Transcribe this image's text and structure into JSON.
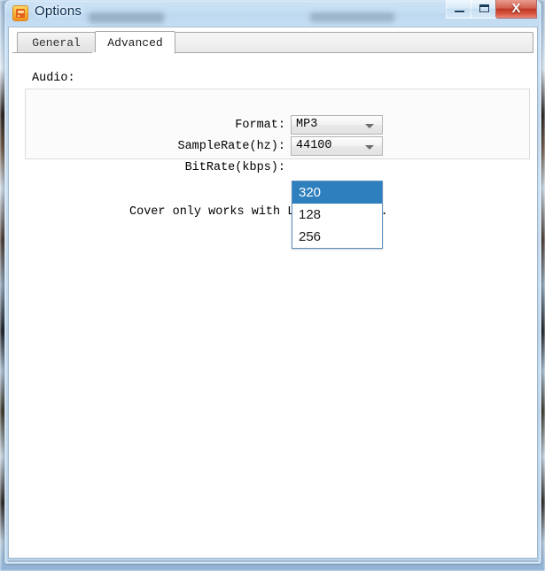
{
  "window": {
    "title": "Options",
    "icon": "app-icon",
    "buttons": {
      "minimize": "minimize-icon",
      "maximize": "maximize-icon",
      "close_label": "X"
    }
  },
  "tabs": [
    {
      "label": "General",
      "active": false
    },
    {
      "label": "Advanced",
      "active": true
    }
  ],
  "page": {
    "section_label": "Audio:",
    "fields": [
      {
        "label": "Format:",
        "value": "MP3"
      },
      {
        "label": "SampleRate(hz):",
        "value": "44100"
      },
      {
        "label": "BitRate(kbps):",
        "value": "320"
      }
    ],
    "bitrate_dropdown": {
      "open": true,
      "selected": "320",
      "options": [
        "320",
        "128",
        "256"
      ]
    },
    "note": "Cover only works with L",
    "note_tail": "files."
  },
  "colors": {
    "highlight": "#2e7fbd",
    "highlight_text": "#ffffff",
    "close_button": "#bd3724",
    "titlebar": "#c4ddf4",
    "content_bg": "#ffffff"
  }
}
